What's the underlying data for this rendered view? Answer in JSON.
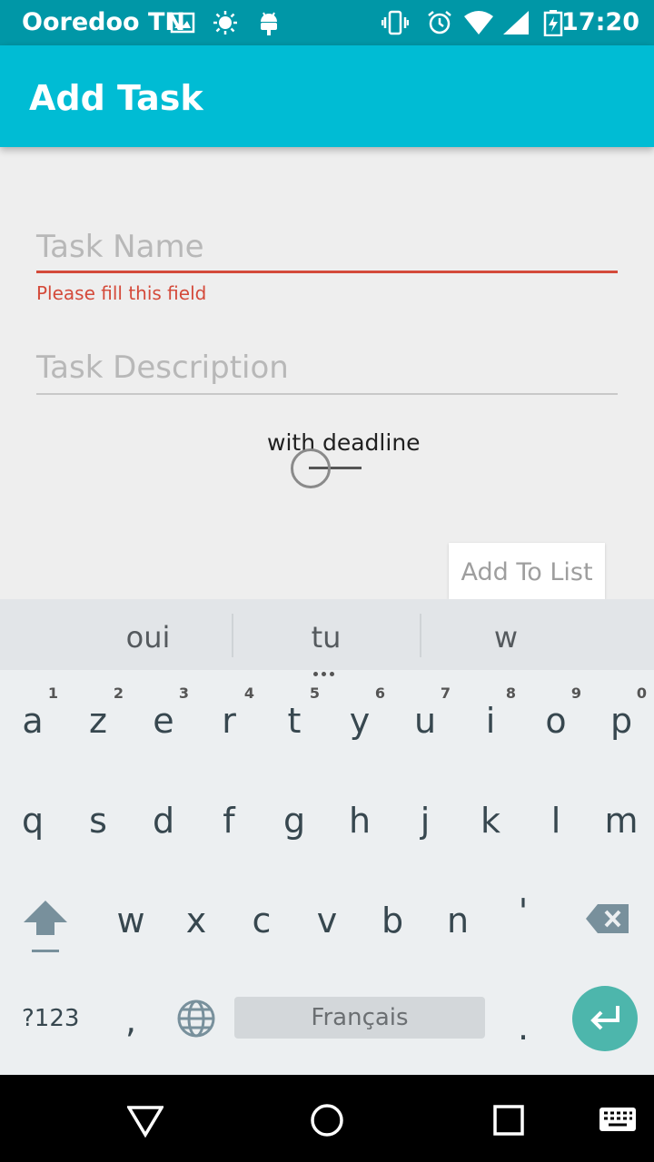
{
  "status_bar": {
    "carrier": "Ooredoo TN",
    "time": "17:20",
    "icons": [
      "image-icon",
      "brightness-icon",
      "android-icon",
      "vibrate-icon",
      "alarm-icon",
      "wifi-icon",
      "signal-icon",
      "battery-charging-icon"
    ]
  },
  "app_bar": {
    "title": "Add Task"
  },
  "form": {
    "task_name": {
      "placeholder": "Task Name",
      "value": "",
      "error": "Please fill this field"
    },
    "task_description": {
      "placeholder": "Task Description",
      "value": ""
    },
    "deadline_switch": {
      "label": "with deadline",
      "checked": false
    },
    "add_button": {
      "label": "Add To List"
    }
  },
  "keyboard": {
    "suggestions": [
      "oui",
      "tu",
      "w"
    ],
    "row1": [
      {
        "key": "a",
        "hint": "1"
      },
      {
        "key": "z",
        "hint": "2"
      },
      {
        "key": "e",
        "hint": "3"
      },
      {
        "key": "r",
        "hint": "4"
      },
      {
        "key": "t",
        "hint": "5"
      },
      {
        "key": "y",
        "hint": "6"
      },
      {
        "key": "u",
        "hint": "7"
      },
      {
        "key": "i",
        "hint": "8"
      },
      {
        "key": "o",
        "hint": "9"
      },
      {
        "key": "p",
        "hint": "0"
      }
    ],
    "row2": [
      "q",
      "s",
      "d",
      "f",
      "g",
      "h",
      "j",
      "k",
      "l",
      "m"
    ],
    "row3": [
      "w",
      "x",
      "c",
      "v",
      "b",
      "n",
      "'"
    ],
    "symbols_label": "?123",
    "comma": ",",
    "period": ".",
    "space_label": "Français",
    "accent_color": "#4db6ac"
  },
  "nav_bar": {
    "icons": [
      "back-icon",
      "home-icon",
      "recents-icon",
      "keyboard-switch-icon"
    ]
  }
}
